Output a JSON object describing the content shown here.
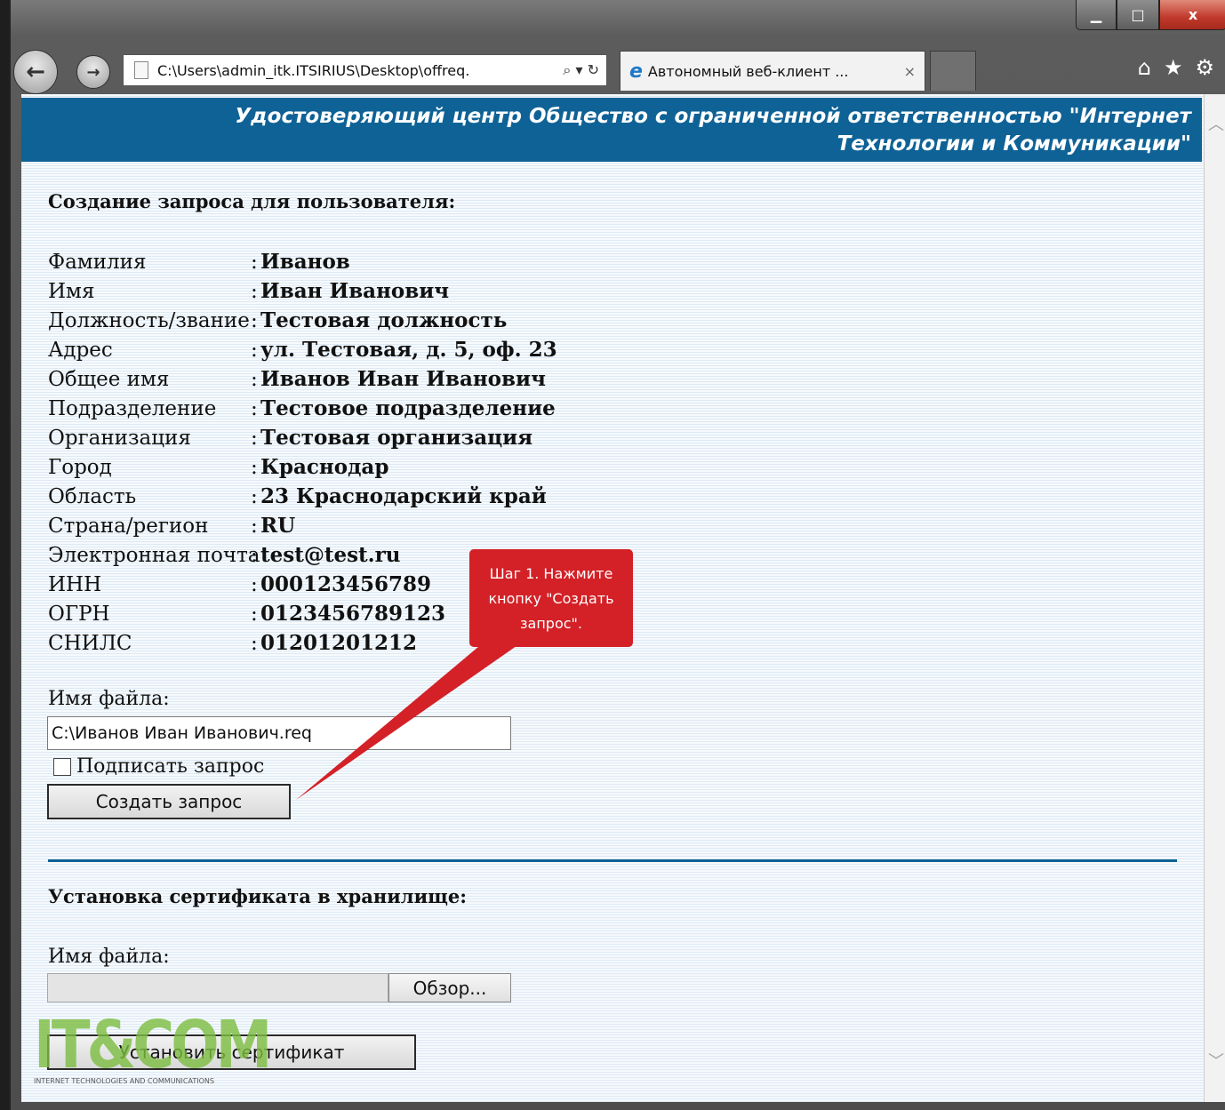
{
  "browser": {
    "address": "C:\\Users\\admin_itk.ITSIRIUS\\Desktop\\offreq.",
    "address_tools": "⌕ ▾ ↻",
    "tab_title": "Автономный веб-клиент ...",
    "tab_close": "×",
    "caption": {
      "min": "▁",
      "max": "□",
      "close": "x"
    },
    "right_icons": {
      "home": "⌂",
      "favorites": "★",
      "tools": "⚙"
    }
  },
  "page": {
    "banner_line1": "Удостоверяющий центр Общество с ограниченной ответственностью \"Интернет",
    "banner_line2": "Технологии и Коммуникации\"",
    "request_title": "Создание запроса для пользователя:",
    "fields": [
      {
        "label": "Фамилия",
        "sep": ":",
        "value": "Иванов"
      },
      {
        "label": "Имя",
        "sep": ":",
        "value": "Иван Иванович"
      },
      {
        "label": "Должность/звание",
        "sep": ":",
        "value": "Тестовая должность"
      },
      {
        "label": "Адрес",
        "sep": ":",
        "value": "ул. Тестовая, д. 5, оф. 23"
      },
      {
        "label": "Общее имя",
        "sep": ":",
        "value": "Иванов Иван Иванович"
      },
      {
        "label": "Подразделение",
        "sep": ":",
        "value": "Тестовое подразделение"
      },
      {
        "label": "Организация",
        "sep": ":",
        "value": "Тестовая организация"
      },
      {
        "label": "Город",
        "sep": ":",
        "value": "Краснодар"
      },
      {
        "label": "Область",
        "sep": ":",
        "value": "23 Краснодарский край"
      },
      {
        "label": "Страна/регион",
        "sep": ":",
        "value": "RU"
      },
      {
        "label": "Электронная почта",
        "sep": ":",
        "value": "test@test.ru"
      },
      {
        "label": "ИНН",
        "sep": ":",
        "value": "000123456789"
      },
      {
        "label": "ОГРН",
        "sep": ":",
        "value": "0123456789123"
      },
      {
        "label": "СНИЛС",
        "sep": ":",
        "value": "01201201212"
      }
    ],
    "filename_label": "Имя файла:",
    "filename_value": "C:\\Иванов Иван Иванович.req",
    "sign_label": "Подписать запрос",
    "create_button": "Создать запрос",
    "install_title": "Установка сертификата в хранилище:",
    "install_filename_label": "Имя файла:",
    "browse_button": "Обзор...",
    "install_button": "Установить сертификат"
  },
  "callout": {
    "line1": "Шаг 1. Нажмите",
    "line2": "кнопку \"Создать",
    "line3": "запрос\"."
  },
  "logo": {
    "text": "IT&COM",
    "tagline": "INTERNET TECHNOLOGIES AND COMMUNICATIONS"
  },
  "colors": {
    "banner": "#0e6296",
    "callout": "#d32127",
    "logo_green": "#7cbd40",
    "logo_purple": "#8a3c9a"
  }
}
